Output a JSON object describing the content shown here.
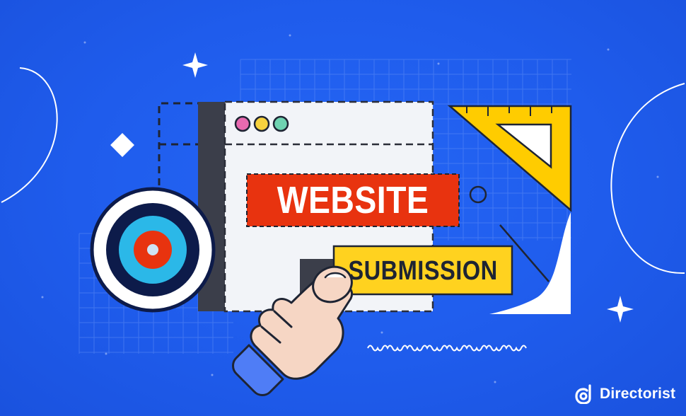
{
  "banner": {
    "line1": "WEBSITE",
    "line2": "SUBMISSION"
  },
  "brand": {
    "name": "Directorist",
    "logo_icon": "directorist-logo-icon"
  },
  "colors": {
    "background": "#1f5fef",
    "banner_red": "#e8330f",
    "banner_yellow": "#ffd21f",
    "target_navy": "#0d1b4a",
    "target_teal": "#2bb8e8",
    "window_dark": "#3b3e4a",
    "dot_pink": "#e86ab0",
    "dot_yellow": "#f7d23e",
    "dot_green": "#6fd3b1",
    "skin": "#f6d6c4",
    "cuff": "#4f7df6"
  },
  "icons": [
    "sparkle-icon",
    "diamond-icon",
    "target-icon",
    "hand-pointer-icon",
    "set-square-icon",
    "circle-icon",
    "wave-icon"
  ]
}
